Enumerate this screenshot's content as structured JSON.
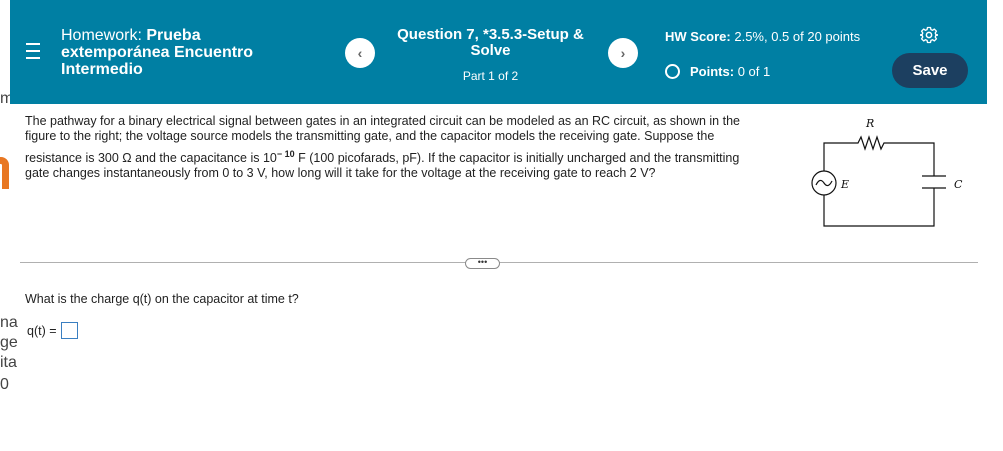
{
  "background_fragments": [
    "m",
    "na",
    "ge",
    "ita",
    "0"
  ],
  "header": {
    "hw_label": "Homework:",
    "hw_name": "Prueba extemporánea Encuentro Intermedio",
    "question_title": "Question 7, *3.5.3-Setup & Solve",
    "part": "Part 1 of 2",
    "score_label": "HW Score:",
    "score_value": "2.5%, 0.5 of 20 points",
    "points_label": "Points:",
    "points_value": "0 of 1",
    "save_label": "Save",
    "accent_color": "#007fa3",
    "save_color": "#1c3f60"
  },
  "problem": {
    "line1": "The pathway for a binary electrical signal between gates in an integrated circuit can be modeled as an RC circuit, as shown in the",
    "line2": "figure to the right; the voltage source models the transmitting gate, and the capacitor models the receiving gate. Suppose the",
    "line3_a": "resistance is 300 Ω and the capacitance is 10",
    "line3_exp": "− 10",
    "line3_b": "F (100 picofarads, pF). If the capacitor is initially uncharged and the transmitting",
    "line4": "gate changes instantaneously from 0 to 3 V, how long will it take for the voltage at the receiving gate to reach 2 V?"
  },
  "circuit": {
    "resistor_label": "R",
    "source_label": "E",
    "capacitor_label": "C"
  },
  "more_label": "•••",
  "question": {
    "text": "What is the charge q(t) on the capacitor at time t?",
    "answer_label": "q(t) =",
    "answer_value": ""
  }
}
